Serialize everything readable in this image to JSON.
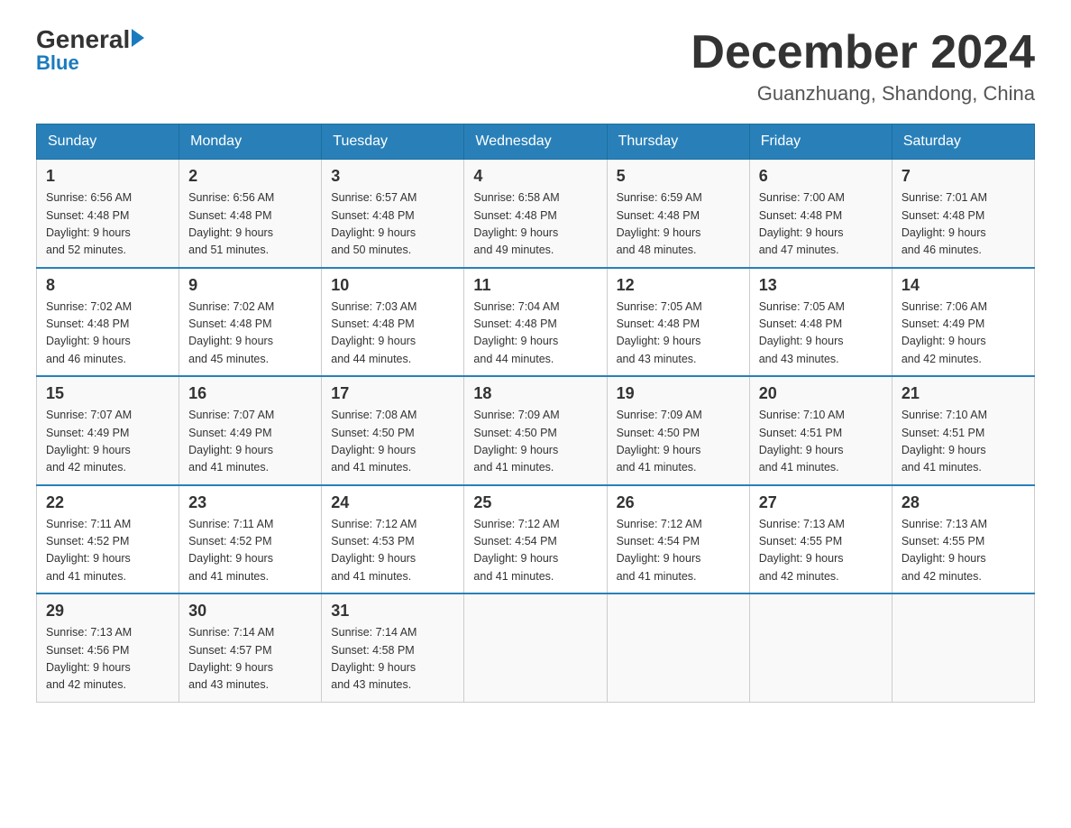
{
  "logo": {
    "general": "General",
    "blue": "Blue"
  },
  "title": "December 2024",
  "location": "Guanzhuang, Shandong, China",
  "days_of_week": [
    "Sunday",
    "Monday",
    "Tuesday",
    "Wednesday",
    "Thursday",
    "Friday",
    "Saturday"
  ],
  "weeks": [
    [
      {
        "day": "1",
        "sunrise": "6:56 AM",
        "sunset": "4:48 PM",
        "daylight": "9 hours and 52 minutes."
      },
      {
        "day": "2",
        "sunrise": "6:56 AM",
        "sunset": "4:48 PM",
        "daylight": "9 hours and 51 minutes."
      },
      {
        "day": "3",
        "sunrise": "6:57 AM",
        "sunset": "4:48 PM",
        "daylight": "9 hours and 50 minutes."
      },
      {
        "day": "4",
        "sunrise": "6:58 AM",
        "sunset": "4:48 PM",
        "daylight": "9 hours and 49 minutes."
      },
      {
        "day": "5",
        "sunrise": "6:59 AM",
        "sunset": "4:48 PM",
        "daylight": "9 hours and 48 minutes."
      },
      {
        "day": "6",
        "sunrise": "7:00 AM",
        "sunset": "4:48 PM",
        "daylight": "9 hours and 47 minutes."
      },
      {
        "day": "7",
        "sunrise": "7:01 AM",
        "sunset": "4:48 PM",
        "daylight": "9 hours and 46 minutes."
      }
    ],
    [
      {
        "day": "8",
        "sunrise": "7:02 AM",
        "sunset": "4:48 PM",
        "daylight": "9 hours and 46 minutes."
      },
      {
        "day": "9",
        "sunrise": "7:02 AM",
        "sunset": "4:48 PM",
        "daylight": "9 hours and 45 minutes."
      },
      {
        "day": "10",
        "sunrise": "7:03 AM",
        "sunset": "4:48 PM",
        "daylight": "9 hours and 44 minutes."
      },
      {
        "day": "11",
        "sunrise": "7:04 AM",
        "sunset": "4:48 PM",
        "daylight": "9 hours and 44 minutes."
      },
      {
        "day": "12",
        "sunrise": "7:05 AM",
        "sunset": "4:48 PM",
        "daylight": "9 hours and 43 minutes."
      },
      {
        "day": "13",
        "sunrise": "7:05 AM",
        "sunset": "4:48 PM",
        "daylight": "9 hours and 43 minutes."
      },
      {
        "day": "14",
        "sunrise": "7:06 AM",
        "sunset": "4:49 PM",
        "daylight": "9 hours and 42 minutes."
      }
    ],
    [
      {
        "day": "15",
        "sunrise": "7:07 AM",
        "sunset": "4:49 PM",
        "daylight": "9 hours and 42 minutes."
      },
      {
        "day": "16",
        "sunrise": "7:07 AM",
        "sunset": "4:49 PM",
        "daylight": "9 hours and 41 minutes."
      },
      {
        "day": "17",
        "sunrise": "7:08 AM",
        "sunset": "4:50 PM",
        "daylight": "9 hours and 41 minutes."
      },
      {
        "day": "18",
        "sunrise": "7:09 AM",
        "sunset": "4:50 PM",
        "daylight": "9 hours and 41 minutes."
      },
      {
        "day": "19",
        "sunrise": "7:09 AM",
        "sunset": "4:50 PM",
        "daylight": "9 hours and 41 minutes."
      },
      {
        "day": "20",
        "sunrise": "7:10 AM",
        "sunset": "4:51 PM",
        "daylight": "9 hours and 41 minutes."
      },
      {
        "day": "21",
        "sunrise": "7:10 AM",
        "sunset": "4:51 PM",
        "daylight": "9 hours and 41 minutes."
      }
    ],
    [
      {
        "day": "22",
        "sunrise": "7:11 AM",
        "sunset": "4:52 PM",
        "daylight": "9 hours and 41 minutes."
      },
      {
        "day": "23",
        "sunrise": "7:11 AM",
        "sunset": "4:52 PM",
        "daylight": "9 hours and 41 minutes."
      },
      {
        "day": "24",
        "sunrise": "7:12 AM",
        "sunset": "4:53 PM",
        "daylight": "9 hours and 41 minutes."
      },
      {
        "day": "25",
        "sunrise": "7:12 AM",
        "sunset": "4:54 PM",
        "daylight": "9 hours and 41 minutes."
      },
      {
        "day": "26",
        "sunrise": "7:12 AM",
        "sunset": "4:54 PM",
        "daylight": "9 hours and 41 minutes."
      },
      {
        "day": "27",
        "sunrise": "7:13 AM",
        "sunset": "4:55 PM",
        "daylight": "9 hours and 42 minutes."
      },
      {
        "day": "28",
        "sunrise": "7:13 AM",
        "sunset": "4:55 PM",
        "daylight": "9 hours and 42 minutes."
      }
    ],
    [
      {
        "day": "29",
        "sunrise": "7:13 AM",
        "sunset": "4:56 PM",
        "daylight": "9 hours and 42 minutes."
      },
      {
        "day": "30",
        "sunrise": "7:14 AM",
        "sunset": "4:57 PM",
        "daylight": "9 hours and 43 minutes."
      },
      {
        "day": "31",
        "sunrise": "7:14 AM",
        "sunset": "4:58 PM",
        "daylight": "9 hours and 43 minutes."
      },
      null,
      null,
      null,
      null
    ]
  ],
  "labels": {
    "sunrise": "Sunrise:",
    "sunset": "Sunset:",
    "daylight": "Daylight:"
  }
}
